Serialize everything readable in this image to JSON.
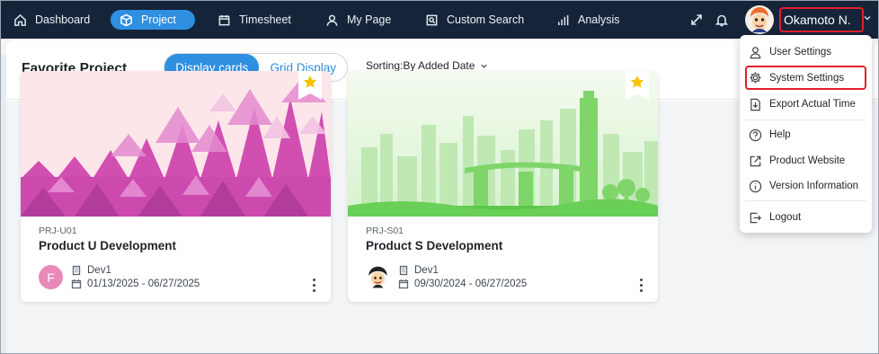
{
  "nav": {
    "items": [
      {
        "label": "Dashboard",
        "icon": "home-icon"
      },
      {
        "label": "Project",
        "icon": "cube-icon",
        "active": true
      },
      {
        "label": "Timesheet",
        "icon": "calendar-icon"
      },
      {
        "label": "My Page",
        "icon": "person-icon"
      },
      {
        "label": "Custom Search",
        "icon": "search-doc-icon"
      },
      {
        "label": "Analysis",
        "icon": "bar-chart-icon"
      }
    ],
    "user_name": "Okamoto N.",
    "accent_color": "#2f8fe0",
    "highlight_color": "#e0202a"
  },
  "page": {
    "title": "Favorite Project",
    "view_toggle": {
      "active": "Display cards",
      "inactive": "Grid Display"
    },
    "sorting": "Sorting:By Added Date"
  },
  "cards": [
    {
      "code": "PRJ-U01",
      "name": "Product U Development",
      "team": "Dev1",
      "dates": "01/13/2025 - 06/27/2025",
      "avatar_letter": "F",
      "avatar_color": "#e989b8",
      "favorite": true
    },
    {
      "code": "PRJ-S01",
      "name": "Product S Development",
      "team": "Dev1",
      "dates": "09/30/2024 - 06/27/2025",
      "avatar_letter": "",
      "favorite": true
    }
  ],
  "user_menu": {
    "items": [
      {
        "label": "User Settings",
        "icon": "user-icon"
      },
      {
        "label": "System Settings",
        "icon": "gear-icon",
        "highlighted": true
      },
      {
        "label": "Export Actual Time",
        "icon": "export-file-icon"
      },
      {
        "label": "Help",
        "icon": "help-icon"
      },
      {
        "label": "Product Website",
        "icon": "external-link-icon"
      },
      {
        "label": "Version Information",
        "icon": "info-icon"
      },
      {
        "label": "Logout",
        "icon": "logout-icon"
      }
    ]
  }
}
